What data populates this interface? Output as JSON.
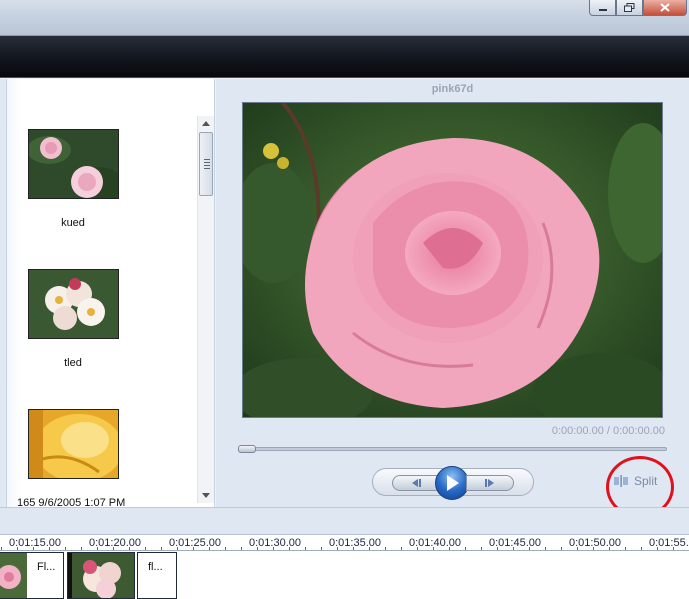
{
  "window": {
    "minimize_icon": "minimize-icon",
    "maximize_icon": "restore-icon",
    "close_icon": "close-icon"
  },
  "library": {
    "items": [
      {
        "caption": "kued"
      },
      {
        "caption": "tled"
      },
      {
        "caption": "165 9/6/2005 1:07 PM"
      }
    ]
  },
  "preview": {
    "clip_title": "pink67d",
    "time": "0:00:00.00 / 0:00:00.00",
    "progress": 0,
    "split_label": "Split",
    "split_icon": "split-icon"
  },
  "timeline": {
    "ticks": [
      "0:01:15.00",
      "0:01:20.00",
      "0:01:25.00",
      "0:01:30.00",
      "0:01:35.00",
      "0:01:40.00",
      "0:01:45.00",
      "0:01:50.00",
      "0:01:55."
    ],
    "clips": [
      {
        "label": "Fl..."
      },
      {
        "label": "fl..."
      }
    ]
  },
  "colors": {
    "annotation": "#e0111a",
    "play": "#2a6cc7"
  }
}
